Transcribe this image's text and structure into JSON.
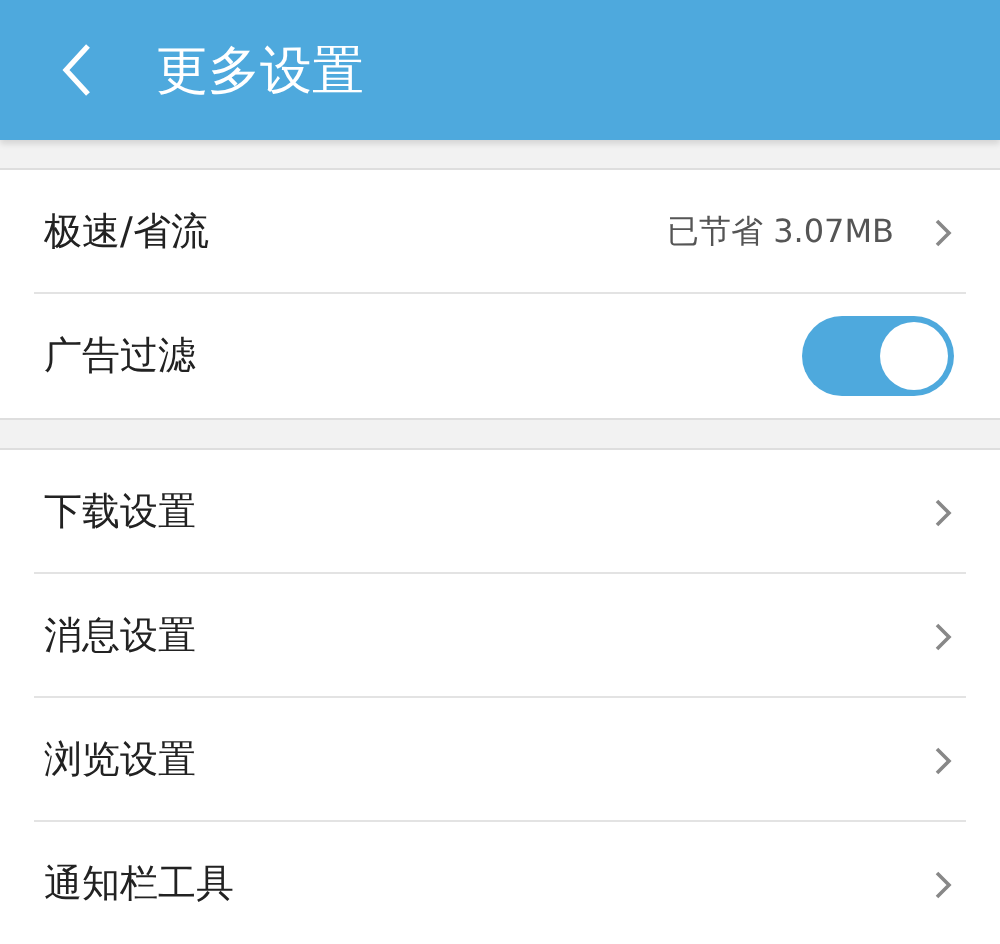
{
  "header": {
    "title": "更多设置"
  },
  "groups": [
    {
      "rows": [
        {
          "kind": "link",
          "label": "极速/省流",
          "value": "已节省 3.07MB"
        },
        {
          "kind": "toggle",
          "label": "广告过滤",
          "on": true
        }
      ]
    },
    {
      "rows": [
        {
          "kind": "link",
          "label": "下载设置"
        },
        {
          "kind": "link",
          "label": "消息设置"
        },
        {
          "kind": "link",
          "label": "浏览设置"
        },
        {
          "kind": "link",
          "label": "通知栏工具"
        }
      ]
    }
  ]
}
